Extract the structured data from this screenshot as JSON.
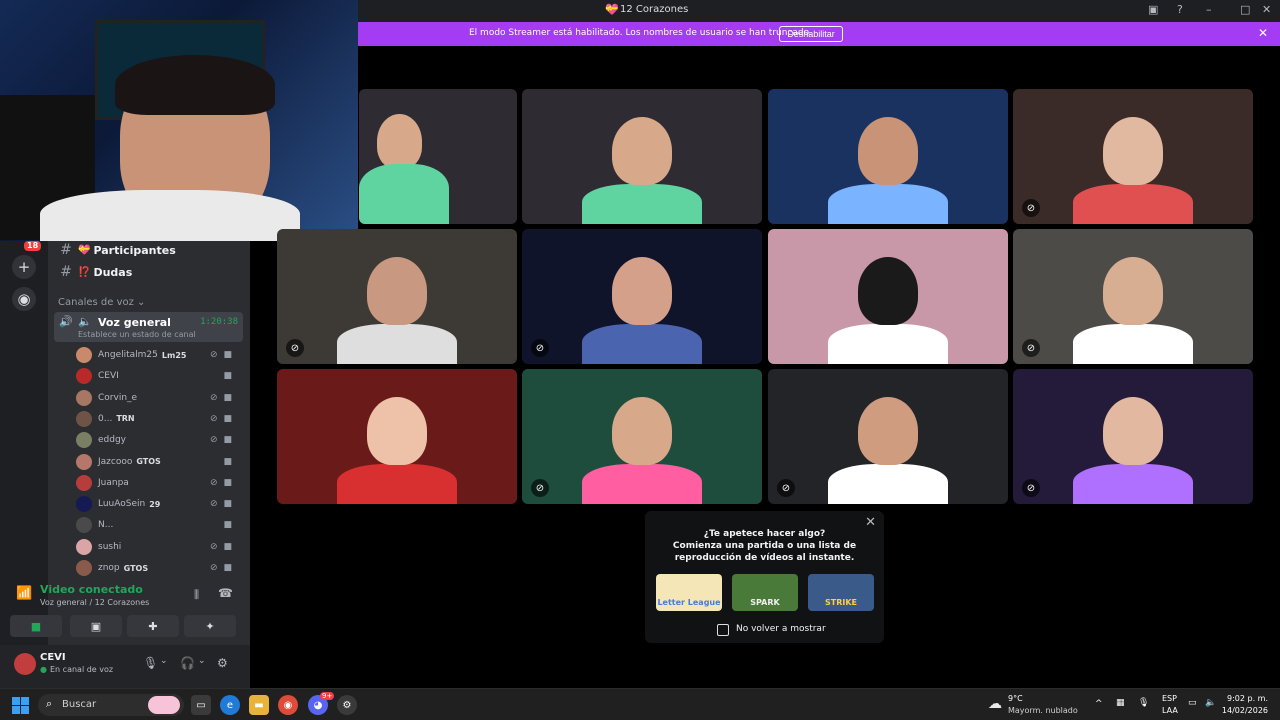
{
  "window": {
    "title": "12 Corazones",
    "controls": [
      "monitor-icon",
      "help-icon",
      "minimize-icon",
      "maximize-icon",
      "close-icon"
    ]
  },
  "streamer_banner": {
    "text": "El modo Streamer está habilitado. Los nombres de usuario se han truncado.",
    "button": "Deshabilitar",
    "color": "#a33cf2"
  },
  "rail": {
    "badge": "18",
    "add_icon": "plus-icon",
    "discover_icon": "compass-icon"
  },
  "sidebar": {
    "text_channels": [
      {
        "emoji": "💝",
        "name": "Participantes"
      },
      {
        "emoji": "⁉️",
        "name": "Dudas"
      }
    ],
    "voice_section_label": "Canales de voz",
    "voice_channel": {
      "name": "Voz general",
      "timer": "1:20:38",
      "status": "Establece un estado de canal"
    },
    "members": [
      {
        "name": "Angelitalm25",
        "tag": "Lm25",
        "avatar": "#c98a6b",
        "muted": true
      },
      {
        "name": "CEVI",
        "tag": "",
        "avatar": "#b82a2a",
        "muted": false
      },
      {
        "name": "Corvin_e",
        "tag": "",
        "avatar": "#a87763",
        "muted": true
      },
      {
        "name": "0...",
        "tag": "TRN",
        "avatar": "#6f5346",
        "muted": true
      },
      {
        "name": "eddgy",
        "tag": "",
        "avatar": "#7a7f63",
        "muted": true
      },
      {
        "name": "Jazcooo",
        "tag": "GTOS",
        "avatar": "#b5776a",
        "muted": false
      },
      {
        "name": "Juanpa",
        "tag": "",
        "avatar": "#b73d3d",
        "muted": true
      },
      {
        "name": "LuuAoSein",
        "tag": "29",
        "avatar": "#151a55",
        "muted": true
      },
      {
        "name": "N...",
        "tag": "",
        "avatar": "#4a4a4a",
        "muted": false
      },
      {
        "name": "sushi",
        "tag": "",
        "avatar": "#d9a5a5",
        "muted": true
      },
      {
        "name": "znop",
        "tag": "GTOS",
        "avatar": "#8a5a4a",
        "muted": true
      }
    ],
    "rtc": {
      "title": "Video conectado",
      "subtitle": "Voz general / 12 Corazones",
      "status_color": "#23a55a"
    },
    "user": {
      "name": "CEVI",
      "status": "En canal de voz"
    }
  },
  "video_tiles": [
    {
      "bg": "#2e2b33",
      "accent": "#5fd4a0",
      "skin": "#d7a98a",
      "muted": false
    },
    {
      "bg": "#1a3260",
      "accent": "#7ab3ff",
      "skin": "#c99378",
      "muted": false
    },
    {
      "bg": "#3a2b28",
      "accent": "#e05050",
      "skin": "#e0b9a0",
      "muted": true
    },
    {
      "bg": "#3d3a36",
      "accent": "#dedede",
      "skin": "#c89880",
      "muted": true
    },
    {
      "bg": "#10142b",
      "accent": "#4a64b0",
      "skin": "#d4a08a",
      "muted": true
    },
    {
      "bg": "#c898a8",
      "accent": "#ffffff",
      "skin": "#1a1a1a",
      "muted": false
    },
    {
      "bg": "#4c4b47",
      "accent": "#ffffff",
      "skin": "#d8ae92",
      "muted": true
    },
    {
      "bg": "#6b1a1a",
      "accent": "#d83030",
      "skin": "#edc2a8",
      "muted": false
    },
    {
      "bg": "#1f4d3d",
      "accent": "#ff5fa0",
      "skin": "#d8a88a",
      "muted": true
    },
    {
      "bg": "#232428",
      "accent": "#ffffff",
      "skin": "#cf9c80",
      "muted": true
    },
    {
      "bg": "#241a3a",
      "accent": "#b070ff",
      "skin": "#e2b8a0",
      "muted": true
    },
    {
      "bg": "#0d1fd6",
      "accent": "#0a0a2a",
      "skin": "#0d1fd6",
      "muted": true
    }
  ],
  "activity_popup": {
    "title": "¿Te apetece hacer algo?",
    "desc_line1": "Comienza una partida o una lista de",
    "desc_line2": "reproducción de vídeos al instante.",
    "games": [
      {
        "label": "Letter League",
        "bg": "#f5e6b8",
        "fg": "#4a7ad8"
      },
      {
        "label": "SPARK",
        "bg": "#4a7a3a",
        "fg": "#f0f0f0"
      },
      {
        "label": "STRIKE",
        "bg": "#3a5a8a",
        "fg": "#ffd040"
      }
    ],
    "checkbox_label": "No volver a mostrar"
  },
  "taskbar": {
    "search_placeholder": "Buscar",
    "apps": [
      "task-view-icon",
      "edge-icon",
      "explorer-icon",
      "chrome-icon",
      "discord-icon",
      "settings-icon"
    ],
    "discord_badge": "9+",
    "weather_temp": "9°C",
    "weather_desc": "Mayorm. nublado",
    "lang_top": "ESP",
    "lang_bottom": "LAA",
    "time": "9:02 p. m.",
    "date": "14/02/2026"
  }
}
